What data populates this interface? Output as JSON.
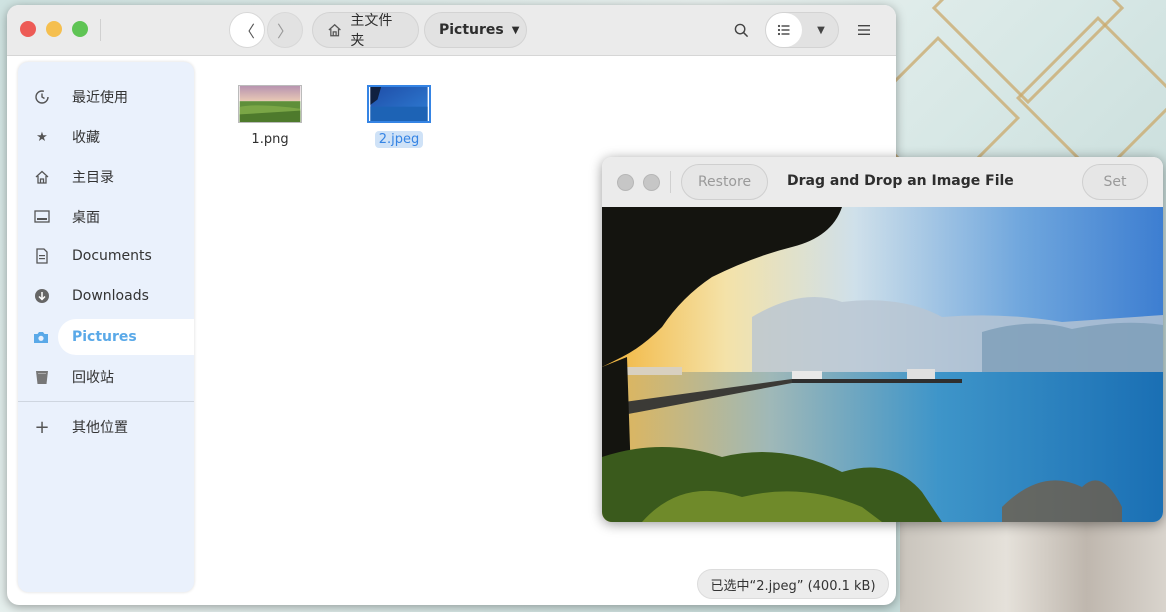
{
  "file_manager": {
    "nav": {
      "back_icon": "〈",
      "forward_icon": "〉"
    },
    "breadcrumbs": {
      "home_label": "主文件夹",
      "current_label": "Pictures"
    },
    "sidebar": {
      "items": [
        {
          "icon": "recent-icon",
          "label": "最近使用"
        },
        {
          "icon": "star-icon",
          "label": "收藏"
        },
        {
          "icon": "home-icon",
          "label": "主目录"
        },
        {
          "icon": "desktop-icon",
          "label": "桌面"
        },
        {
          "icon": "documents-icon",
          "label": "Documents"
        },
        {
          "icon": "downloads-icon",
          "label": "Downloads"
        },
        {
          "icon": "camera-icon",
          "label": "Pictures",
          "active": true
        },
        {
          "icon": "trash-icon",
          "label": "回收站"
        },
        {
          "icon": "plus-icon",
          "label": "其他位置"
        }
      ]
    },
    "files": [
      {
        "name": "1.png",
        "selected": false
      },
      {
        "name": "2.jpeg",
        "selected": true
      }
    ],
    "status": "已选中“2.jpeg” (400.1 kB)"
  },
  "drag_drop_window": {
    "title": "Drag and Drop an Image File",
    "restore_label": "Restore",
    "set_label": "Set"
  },
  "colors": {
    "accent": "#3584e4",
    "sidebar_active": "#5aa9e8",
    "close": "#ed5b56",
    "minimize": "#f5bf4f",
    "maximize": "#5fc454"
  }
}
